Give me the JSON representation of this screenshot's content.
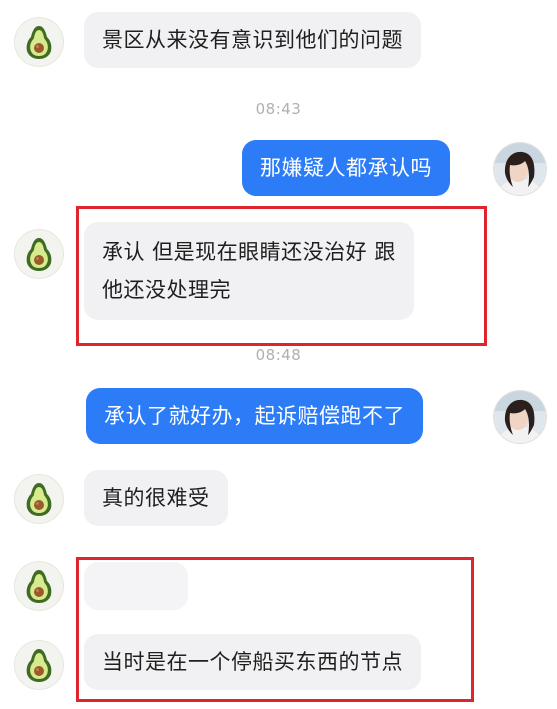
{
  "colors": {
    "incoming_bubble": "#f1f1f3",
    "outgoing_bubble": "#2b7cf6",
    "highlight_box": "#e0242b",
    "timestamp": "#b0b0b0"
  },
  "icons": {
    "contact_avatar": "avocado-icon",
    "user_avatar": "profile-photo"
  },
  "messages": [
    {
      "side": "incoming",
      "text": "景区从来没有意识到他们的问题"
    },
    {
      "type": "timestamp",
      "text": "08:43"
    },
    {
      "side": "outgoing",
      "text": "那嫌疑人都承认吗"
    },
    {
      "side": "incoming",
      "line1": "承认 但是现在眼睛还没治好 跟",
      "line2": "他还没处理完",
      "highlighted": true
    },
    {
      "type": "timestamp",
      "text": "08:48"
    },
    {
      "side": "outgoing",
      "text": "承认了就好办，起诉赔偿跑不了"
    },
    {
      "side": "incoming",
      "text": "真的很难受"
    },
    {
      "side": "incoming",
      "text": "",
      "blurred": true,
      "highlighted": true
    },
    {
      "side": "incoming",
      "text": "当时是在一个停船买东西的节点",
      "highlighted": true
    }
  ]
}
